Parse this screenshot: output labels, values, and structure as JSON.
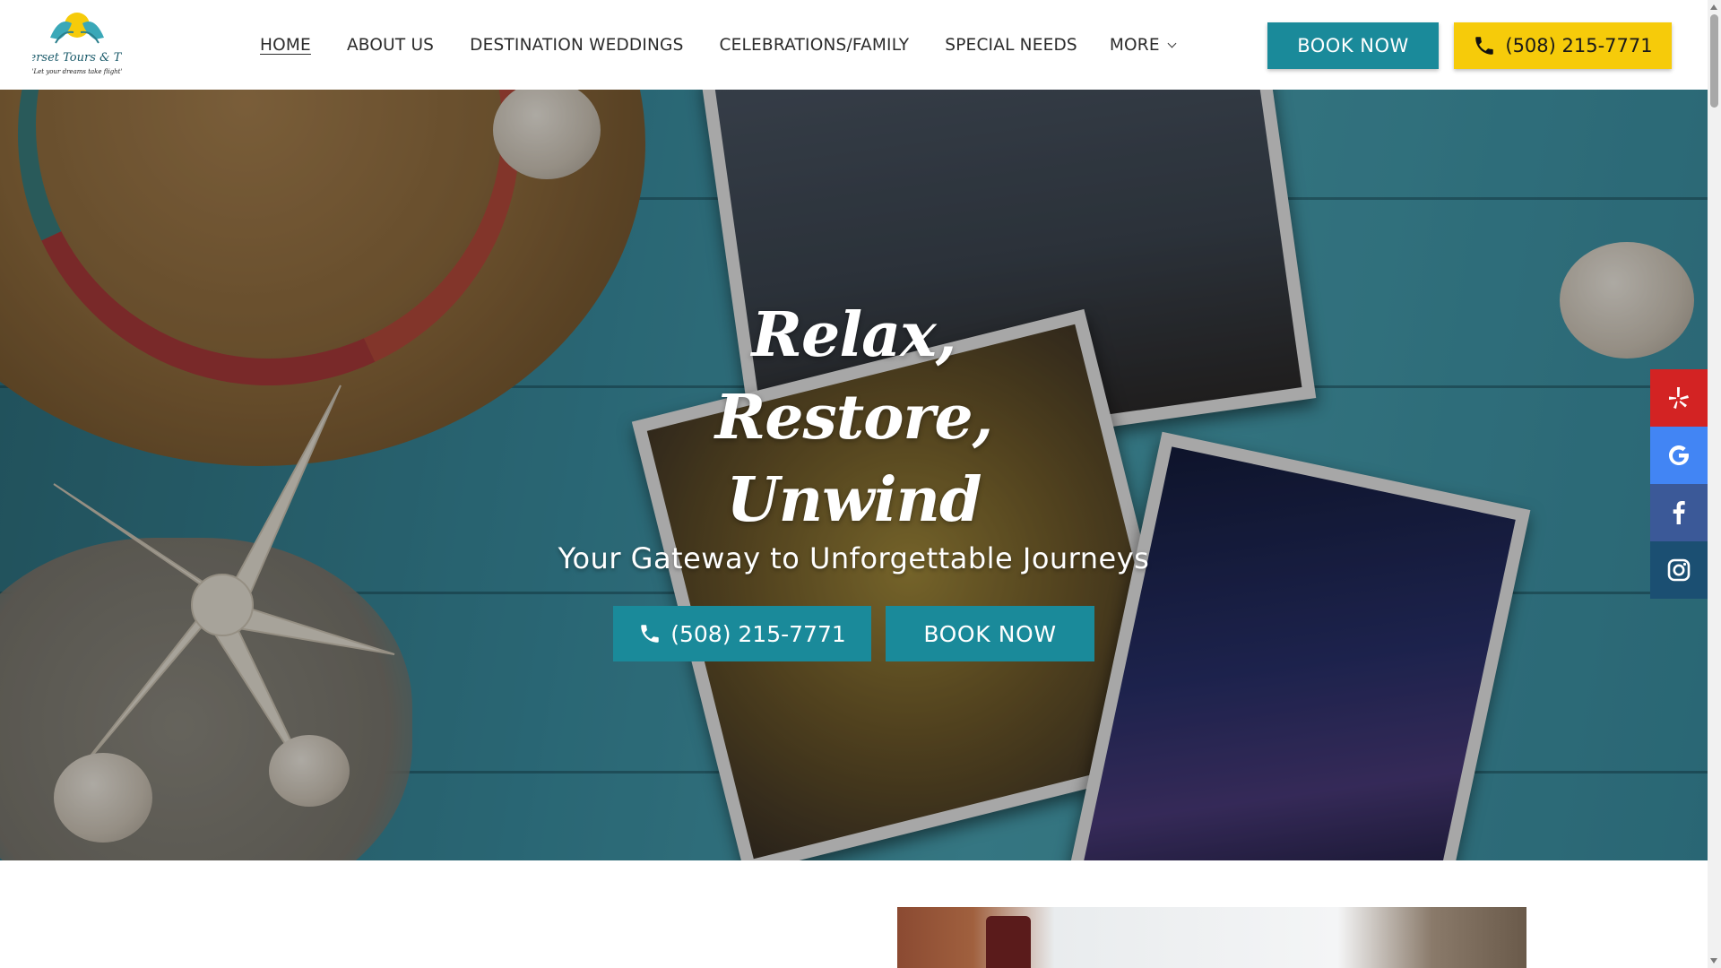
{
  "header": {
    "logo_name": "Somerset Tours & Travel",
    "logo_tagline": "\"Let your dreams take flight\"",
    "nav": [
      {
        "label": "HOME",
        "active": true
      },
      {
        "label": "ABOUT US"
      },
      {
        "label": "DESTINATION WEDDINGS"
      },
      {
        "label": "CELEBRATIONS/FAMILY"
      },
      {
        "label": "SPECIAL NEEDS"
      }
    ],
    "more_label": "MORE",
    "book_label": "BOOK NOW",
    "phone_label": "(508) 215-7771"
  },
  "hero": {
    "title_lines": [
      "Relax,",
      "Restore,",
      "Unwind"
    ],
    "subtitle": "Your Gateway to Unforgettable Journeys",
    "phone_label": "(508) 215-7771",
    "book_label": "BOOK NOW"
  },
  "social": [
    {
      "name": "yelp",
      "color": "#d32323"
    },
    {
      "name": "google",
      "color": "#4285f4"
    },
    {
      "name": "facebook",
      "color": "#3b5998"
    },
    {
      "name": "instagram",
      "color": "#1b4f72"
    }
  ],
  "colors": {
    "teal": "#1a8a9a",
    "yellow": "#f6cb0a"
  }
}
